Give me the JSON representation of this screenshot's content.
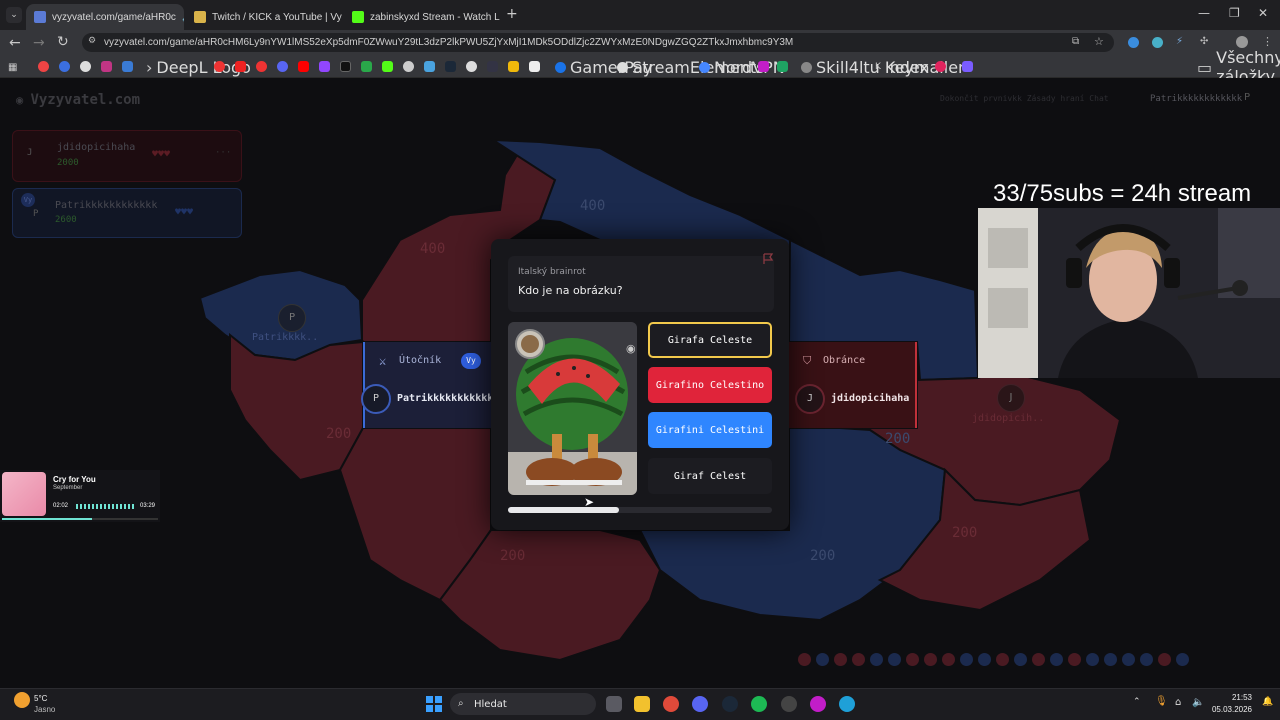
{
  "browser": {
    "tabs": [
      {
        "title": "vyzyvatel.com/game/aHR0c",
        "active": true
      },
      {
        "title": "Twitch / KICK a YouTube | Vyzy",
        "active": false
      },
      {
        "title": "zabinskyxd Stream - Watch Live",
        "active": false
      }
    ],
    "new_tab": "+",
    "url": "vyzyvatel.com/game/aHR0cHM6Ly9nYW1lMS52eXp5dmF0ZWwuY29tL3dzP2lkPWU5ZjYxMjI1MDk5ODdlZjc2ZWYxMzE0NDgwZGQ2ZTkxJmxhbmc9Y3M",
    "bookmarks": [
      "DeepL Logo",
      "GamerPay",
      "StreamElements",
      "NordVPN",
      "Skill4ltu Index",
      "Keymailer"
    ],
    "all_bookmarks": "Všechny záložky"
  },
  "game": {
    "logo": "Vyzyvatel.com",
    "topnav": "Dokončit prvnivkk   Zásady hraní   Chat",
    "top_user": "Patrikkkkkkkkkkkk",
    "top_avatar": "P",
    "players": [
      {
        "name": "jdidopicihaha",
        "avatar": "J",
        "score": "2000",
        "hearts": "♥♥♥",
        "more": "···"
      },
      {
        "name": "Patrikkkkkkkkkkkk",
        "avatar": "P",
        "score": "2600",
        "hearts": "♥♥♥",
        "badge": "Vy"
      }
    ],
    "map_values": [
      "400",
      "400",
      "200",
      "200",
      "200",
      "200",
      "200",
      "200"
    ],
    "map_labels": [
      {
        "avatar": "P",
        "name": "Patrikkkk.."
      },
      {
        "avatar": "J",
        "name": "jdidopicih.."
      }
    ],
    "attacker": {
      "label": "Útočník",
      "badge": "Vy",
      "avatar": "P",
      "name": "Patrikkkkkkkkkkkk"
    },
    "defender": {
      "label": "Obránce",
      "avatar": "J",
      "name": "jdidopicihaha"
    },
    "question": {
      "category": "Italský brainrot",
      "text": "Kdo je na obrázku?",
      "answers": [
        {
          "label": "Girafa Celeste",
          "state": "outlined",
          "color": "#f2c94c"
        },
        {
          "label": "Girafino Celestino",
          "state": "red",
          "color": "#e0243a"
        },
        {
          "label": "Girafini Celestini",
          "state": "blue",
          "color": "#2f86ff"
        },
        {
          "label": "Giraf Celest",
          "state": "neutral",
          "color": "#1c1c21"
        }
      ],
      "timer_progress": 0.42
    }
  },
  "stream": {
    "overlay_text": "33/75subs = 24h stream"
  },
  "music": {
    "title": "Cry for You",
    "artist": "September",
    "elapsed": "02:02",
    "duration": "03:29",
    "progress": 0.58
  },
  "taskbar": {
    "weather_temp": "5°C",
    "weather_desc": "Jasno",
    "search_placeholder": "Hledat",
    "time": "21:53",
    "date": "05.03.2026"
  }
}
